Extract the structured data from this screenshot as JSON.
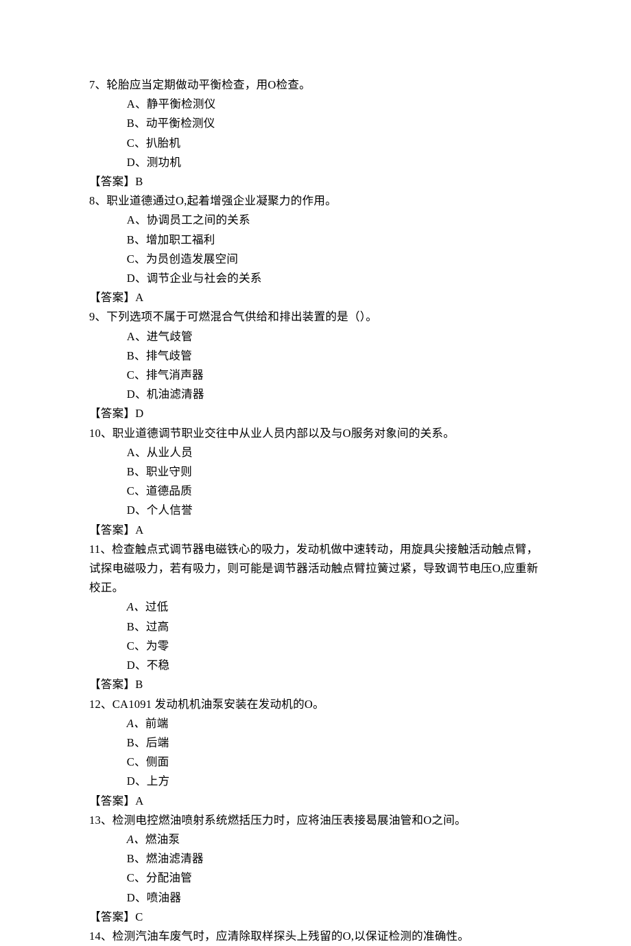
{
  "answerLabelOpen": "【答案】",
  "questions": [
    {
      "num": "7",
      "stem": "、轮胎应当定期做动平衡检查，用O检查。",
      "options": [
        {
          "label": "A、",
          "text": "静平衡检测仪",
          "em": false
        },
        {
          "label": "B、",
          "text": "动平衡检测仪",
          "em": false
        },
        {
          "label": "C、",
          "text": "扒胎机",
          "em": false
        },
        {
          "label": "D、",
          "text": "测功机",
          "em": false
        }
      ],
      "answer": "B"
    },
    {
      "num": "8",
      "stem": "、职业道德通过O,起着增强企业凝聚力的作用。",
      "options": [
        {
          "label": "A、",
          "text": "协调员工之间的关系",
          "em": false
        },
        {
          "label": "B、",
          "text": "增加职工福利",
          "em": false
        },
        {
          "label": "C、",
          "text": "为员创造发展空间",
          "em": false
        },
        {
          "label": "D、",
          "text": "调节企业与社会的关系",
          "em": false
        }
      ],
      "answer": "A"
    },
    {
      "num": "9",
      "stem": "、下列选项不属于可燃混合气供给和排出装置的是（）。",
      "options": [
        {
          "label": "A、",
          "text": "进气歧管",
          "em": false
        },
        {
          "label": "B、",
          "text": "排气歧管",
          "em": false
        },
        {
          "label": "C、",
          "text": "排气消声器",
          "em": false
        },
        {
          "label": "D、",
          "text": "机油滤清器",
          "em": false
        }
      ],
      "answer": "D"
    },
    {
      "num": "10",
      "stem": "、职业道德调节职业交往中从业人员内部以及与O服务对象间的关系。",
      "options": [
        {
          "label": "A、",
          "text": "从业人员",
          "em": false
        },
        {
          "label": "B、",
          "text": "职业守则",
          "em": false
        },
        {
          "label": "C、",
          "text": "道德品质",
          "em": false
        },
        {
          "label": "D、",
          "text": "个人信誉",
          "em": false
        }
      ],
      "answer": "A"
    },
    {
      "num": "11",
      "stem": "、检查触点式调节器电磁铁心的吸力，发动机做中速转动，用旋具尖接触活动触点臂，试探电磁吸力，若有吸力，则可能是调节器活动触点臂拉簧过紧，导致调节电压O,应重新校正。",
      "options": [
        {
          "label": "A、",
          "text": "过低",
          "em": true
        },
        {
          "label": "B、",
          "text": "过高",
          "em": false
        },
        {
          "label": "C、",
          "text": "为零",
          "em": false
        },
        {
          "label": "D、",
          "text": "不稳",
          "em": false
        }
      ],
      "answer": "B"
    },
    {
      "num": "12",
      "stem": "、CA1091 发动机机油泵安装在发动机的O。",
      "options": [
        {
          "label": "A、",
          "text": "前端",
          "em": true
        },
        {
          "label": "B、",
          "text": "后端",
          "em": false
        },
        {
          "label": "C、",
          "text": "侧面",
          "em": false
        },
        {
          "label": "D、",
          "text": "上方",
          "em": false
        }
      ],
      "answer": "A"
    },
    {
      "num": "13",
      "stem": "、检测电控燃油喷射系统燃括压力时，应将油压表接曷展油管和O之间。",
      "options": [
        {
          "label": "A、",
          "text": "燃油泵",
          "em": true
        },
        {
          "label": "B、",
          "text": "燃油滤清器",
          "em": false
        },
        {
          "label": "C、",
          "text": "分配油管",
          "em": false
        },
        {
          "label": "D、",
          "text": "喷油器",
          "em": false
        }
      ],
      "answer": "C"
    },
    {
      "num": "14",
      "stem": "、检测汽油车废气时，应清除取样探头上残留的O,以保证检测的准确性。",
      "options": [],
      "answer": null
    }
  ]
}
